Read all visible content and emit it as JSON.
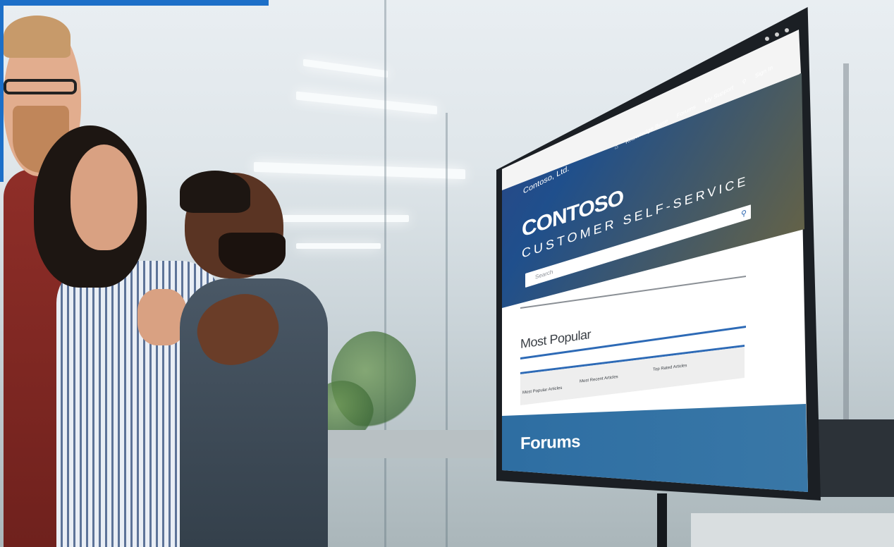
{
  "screen": {
    "site_name": "Contoso, Ltd.",
    "nav": [
      "Knowledge Base",
      "Forums",
      "My Support",
      "Sign In"
    ],
    "hero_title": "CONTOSO",
    "hero_subtitle": "CUSTOMER SELF-SERVICE",
    "search_placeholder": "Search",
    "section_title": "Most Popular",
    "tabs": [
      "Most Popular Articles",
      "Most Recent Articles",
      "Top Rated Articles"
    ],
    "forums_title": "Forums"
  },
  "icons": {
    "home": "home-icon",
    "search_nav": "search-icon",
    "search_button": "search-icon"
  },
  "colors": {
    "accent": "#1c6fc8",
    "rule": "#2d6ab6",
    "forums_band": "#2f6fa3"
  }
}
